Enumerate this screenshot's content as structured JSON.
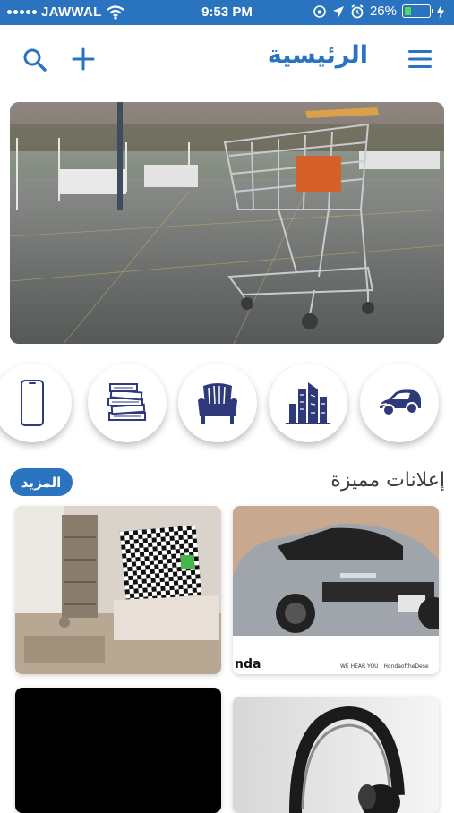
{
  "status_bar": {
    "carrier": "JAWWAL",
    "time": "9:53 PM",
    "battery_percent": "26%",
    "battery_level": 0.26,
    "battery_color": "#4cd964"
  },
  "header": {
    "title": "الرئيسية",
    "icons": [
      "search-icon",
      "plus-icon",
      "hamburger-menu-icon"
    ]
  },
  "hero": {
    "image": "shopping-cart-banner"
  },
  "categories": [
    {
      "icon": "phone-icon"
    },
    {
      "icon": "books-icon"
    },
    {
      "icon": "armchair-icon"
    },
    {
      "icon": "buildings-icon"
    },
    {
      "icon": "car-icon"
    }
  ],
  "featured": {
    "title": "إعلانات مميزة",
    "more_label": "المزيد"
  },
  "cards": [
    {
      "image": "tv-living-room"
    },
    {
      "image": "honda-civic",
      "caption_left": "nda",
      "caption_right": "WE HEAR YOU  |  HondaoftheDese"
    },
    {
      "image": "black-placeholder"
    },
    {
      "image": "headphones"
    }
  ],
  "colors": {
    "accent": "#2a73bf",
    "icon": "#2e3a7a"
  }
}
